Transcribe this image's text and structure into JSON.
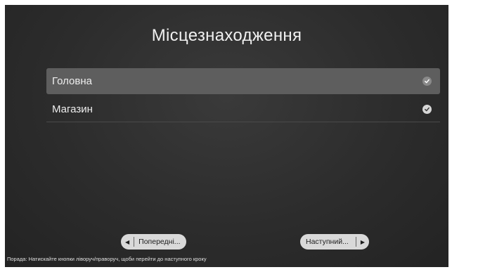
{
  "title": "Місцезнаходження",
  "options": [
    {
      "label": "Головна",
      "selected": true
    },
    {
      "label": "Магазин",
      "selected": false
    }
  ],
  "buttons": {
    "prev_label": "Попередні...",
    "next_label": "Наступний..."
  },
  "hint": "Порада: Натискайте кнопки ліворуч/праворуч, щоби перейти до наступного кроку",
  "colors": {
    "background": "#2c2c2c",
    "selected_row": "#5e5e5e",
    "button": "#d9d9d9"
  }
}
